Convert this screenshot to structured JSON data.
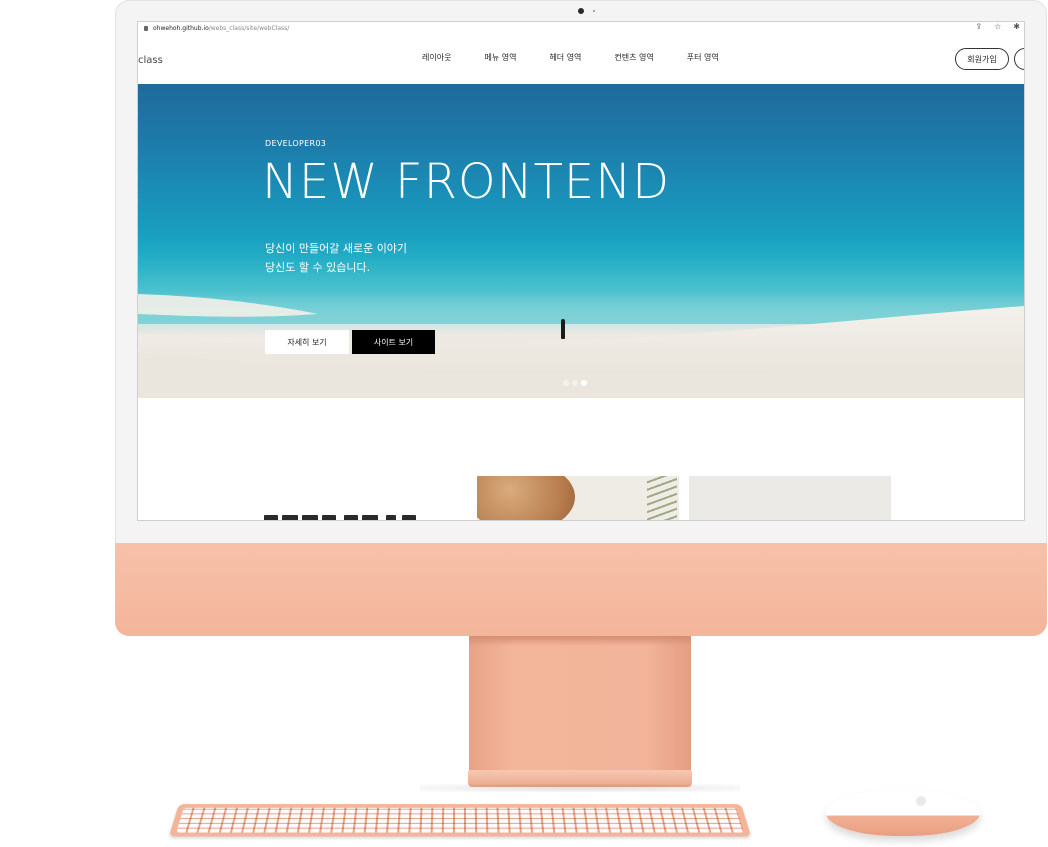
{
  "browser": {
    "url_host": "ohwehoh.github.io",
    "url_path": "/webs_class/site/webClass/"
  },
  "header": {
    "logo": "class",
    "nav": [
      "레이아웃",
      "메뉴 영역",
      "헤더 영역",
      "컨텐츠 영역",
      "푸터 영역"
    ],
    "signup_label": "회원가입"
  },
  "hero": {
    "subtitle": "DEVELOPER03",
    "title": "NEW FRONTEND",
    "desc_line1": "당신이 만들어갈 새로운 이야기",
    "desc_line2": "당신도 할 수 있습니다.",
    "btn_detail": "자세히 보기",
    "btn_site": "사이트 보기",
    "slide_count": 3,
    "active_slide": 3
  },
  "colors": {
    "chin": "#f4b59a",
    "frame": "#f4f4f5",
    "hero_sea": "#1a8fb7"
  }
}
